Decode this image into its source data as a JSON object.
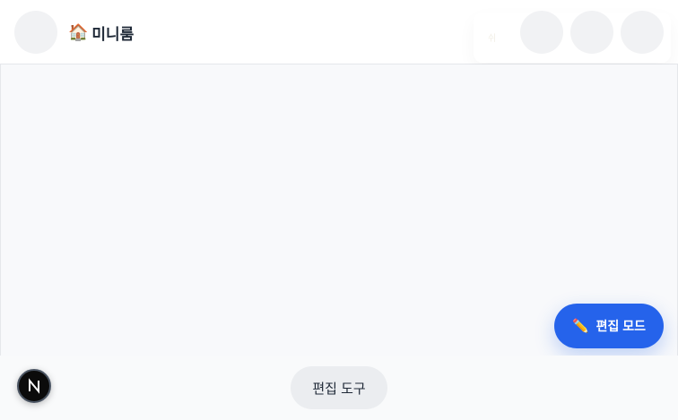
{
  "header": {
    "title": "미니룸",
    "title_icon": "🏠",
    "ghost_text": "쉬"
  },
  "floating": {
    "edit_mode_label": "편집 모드",
    "edit_mode_icon": "✏️",
    "accent": "#2563eb"
  },
  "footer": {
    "tools_label": "편집 도구",
    "badge_letter": "N"
  }
}
